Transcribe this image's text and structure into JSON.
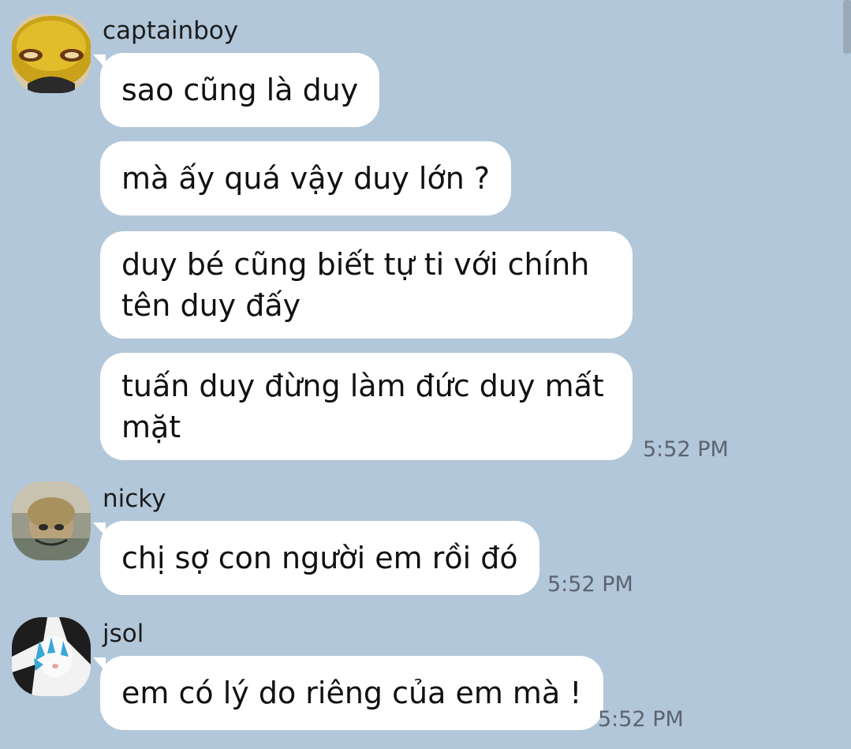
{
  "conversation": {
    "groups": [
      {
        "username": "captainboy",
        "avatar_icon": "yellow-face-avatar",
        "messages": [
          "sao cũng là duy",
          "mà ấy quá vậy duy lớn ?",
          "duy bé cũng biết tự ti với chính tên duy đấy",
          "tuấn duy đừng làm đức duy mất mặt"
        ],
        "time": "5:52 PM"
      },
      {
        "username": "nicky",
        "avatar_icon": "face-photo-avatar",
        "messages": [
          "chị sợ con người em rồi đó"
        ],
        "time": "5:52 PM"
      },
      {
        "username": "jsol",
        "avatar_icon": "cat-photo-avatar",
        "messages": [
          "em có lý do riêng của em mà !"
        ],
        "time": "5:52 PM"
      }
    ]
  },
  "colors": {
    "background": "#b2c7d9",
    "bubble": "#ffffff",
    "time_text": "#5b6470"
  }
}
